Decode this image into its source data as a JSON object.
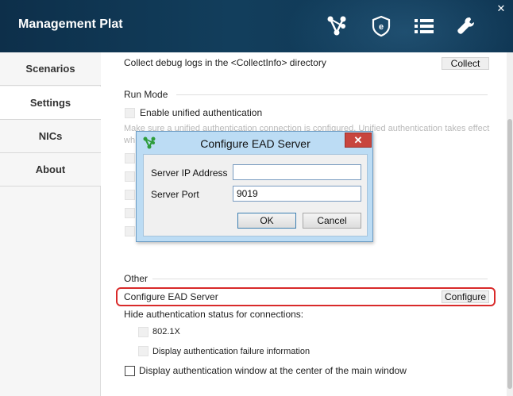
{
  "app": {
    "title": "Management Plat",
    "close_glyph": "✕",
    "toolbar_icons": [
      "network-topology-icon",
      "shield-e-icon",
      "list-icon",
      "wrench-icon"
    ]
  },
  "sidebar": {
    "items": [
      {
        "label": "Scenarios",
        "active": false
      },
      {
        "label": "Settings",
        "active": true
      },
      {
        "label": "NICs",
        "active": false
      },
      {
        "label": "About",
        "active": false
      }
    ]
  },
  "main": {
    "collect": {
      "text": "Collect debug logs in the <CollectInfo> directory",
      "button": "Collect"
    },
    "run_mode": {
      "title": "Run Mode",
      "unified_auth_label": "Enable unified authentication",
      "note_line1": "Make sure a unified authentication connection is configured. Unified authentication takes effect",
      "note_line2": "wh"
    },
    "other": {
      "title": "Other",
      "configure_ead_label": "Configure EAD Server",
      "configure_button": "Configure",
      "hide_status_label": "Hide authentication status for connections:",
      "dot1x_label": "802.1X",
      "failure_info_label": "Display authentication failure information",
      "center_window_label": "Display authentication window at the center of the main window"
    }
  },
  "dialog": {
    "title": "Configure EAD Server",
    "close_glyph": "✕",
    "server_ip_label": "Server IP Address",
    "server_ip_value": "",
    "server_port_label": "Server Port",
    "server_port_value": "9019",
    "ok_label": "OK",
    "cancel_label": "Cancel"
  },
  "colors": {
    "titlebar": "#0d2f4a",
    "highlight": "#d92a2a",
    "dialog_frame": "#bcdcf4",
    "dialog_close": "#c8453e"
  }
}
